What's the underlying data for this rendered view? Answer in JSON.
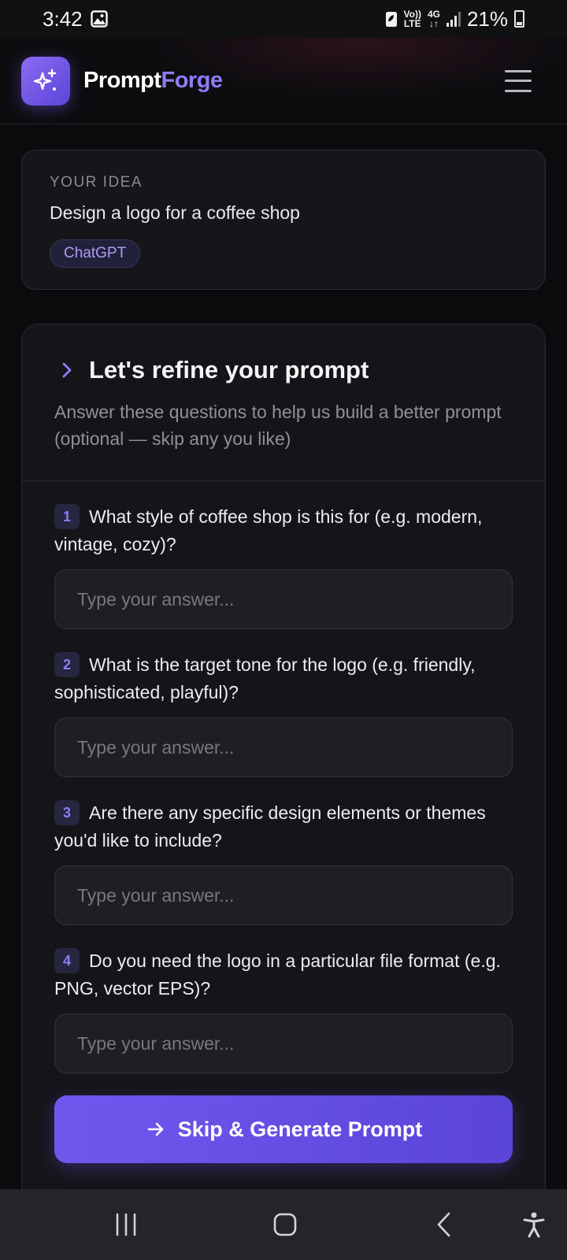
{
  "status_bar": {
    "time": "3:42",
    "volte_top": "Vo))",
    "volte_bottom": "LTE",
    "network": "4G",
    "battery": "21%"
  },
  "header": {
    "brand_part1": "Prompt",
    "brand_part2": "Forge"
  },
  "idea": {
    "label": "YOUR IDEA",
    "text": "Design a logo for a coffee shop",
    "model_chip": "ChatGPT"
  },
  "refine": {
    "title": "Let's refine your prompt",
    "subtitle": "Answer these questions to help us build a better prompt (optional — skip any you like)",
    "questions": [
      {
        "number": "1",
        "text": "What style of coffee shop is this for (e.g. modern, vintage, cozy)?",
        "placeholder": "Type your answer...",
        "value": ""
      },
      {
        "number": "2",
        "text": "What is the target tone for the logo (e.g. friendly, sophisticated, playful)?",
        "placeholder": "Type your answer...",
        "value": ""
      },
      {
        "number": "3",
        "text": "Are there any specific design elements or themes you'd like to include?",
        "placeholder": "Type your answer...",
        "value": ""
      },
      {
        "number": "4",
        "text": "Do you need the logo in a particular file format (e.g. PNG, vector EPS)?",
        "placeholder": "Type your answer...",
        "value": ""
      }
    ],
    "generate_button": "Skip & Generate Prompt"
  },
  "icons": {
    "logo": "sparkles-icon",
    "menu": "hamburger-menu-icon",
    "refine": "chevron-right-icon",
    "generate": "arrow-right-icon",
    "nav": [
      "recent-apps-icon",
      "home-icon",
      "back-icon",
      "accessibility-icon"
    ]
  },
  "colors": {
    "background": "#0b0b0e",
    "accent": "#8e7cf5",
    "button": "#6f58ee",
    "card": "#151519"
  }
}
